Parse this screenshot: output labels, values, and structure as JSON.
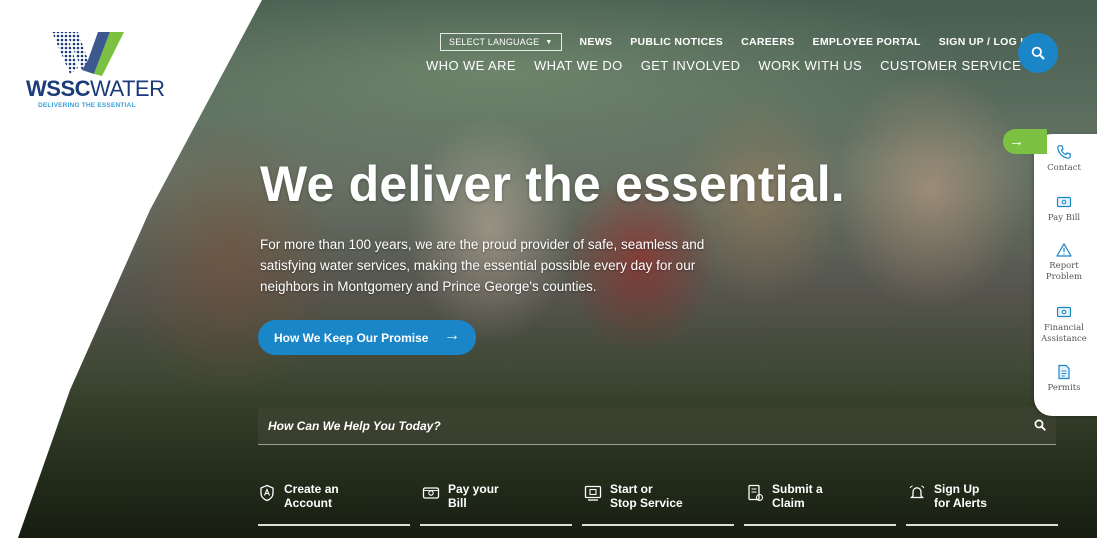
{
  "logo": {
    "word_bold": "WSSC",
    "word_thin": "WATER",
    "tagline": "DELIVERING THE ESSENTIAL",
    "colors": {
      "green": "#7cc142",
      "navy": "#1b3b7a",
      "blue": "#3aa0d8"
    }
  },
  "util_nav": {
    "language": "SELECT LANGUAGE",
    "links": [
      "NEWS",
      "PUBLIC NOTICES",
      "CAREERS",
      "EMPLOYEE PORTAL",
      "SIGN UP / LOG IN"
    ]
  },
  "main_nav": [
    "WHO WE ARE",
    "WHAT WE DO",
    "GET INVOLVED",
    "WORK WITH US",
    "CUSTOMER SERVICE"
  ],
  "hero": {
    "headline": "We deliver the essential.",
    "lede": "For more than 100 years, we are the proud provider of safe, seamless and satisfying water services, making the essential possible every day for our neighbors in Montgomery and Prince George's counties.",
    "cta_label": "How We Keep Our Promise",
    "cta_arrow": "→"
  },
  "help": {
    "placeholder": "How Can We Help You Today?"
  },
  "quick_links": [
    {
      "line1": "Create an",
      "line2": "Account",
      "icon": "shield-icon"
    },
    {
      "line1": "Pay your",
      "line2": "Bill",
      "icon": "bill-icon"
    },
    {
      "line1": "Start or",
      "line2": "Stop Service",
      "icon": "service-icon"
    },
    {
      "line1": "Submit a",
      "line2": "Claim",
      "icon": "claim-icon"
    },
    {
      "line1": "Sign Up",
      "line2": "for Alerts",
      "icon": "alerts-icon"
    }
  ],
  "side_panel": {
    "toggle_arrow": "→",
    "items": [
      {
        "line1": "Contact",
        "line2": "",
        "icon": "phone-icon"
      },
      {
        "line1": "Pay Bill",
        "line2": "",
        "icon": "card-icon"
      },
      {
        "line1": "Report",
        "line2": "Problem",
        "icon": "warning-icon"
      },
      {
        "line1": "Financial",
        "line2": "Assistance",
        "icon": "card-icon"
      },
      {
        "line1": "Permits",
        "line2": "",
        "icon": "document-icon"
      }
    ]
  },
  "colors": {
    "accent_blue": "#1a86c8",
    "accent_green": "#7cc142"
  }
}
